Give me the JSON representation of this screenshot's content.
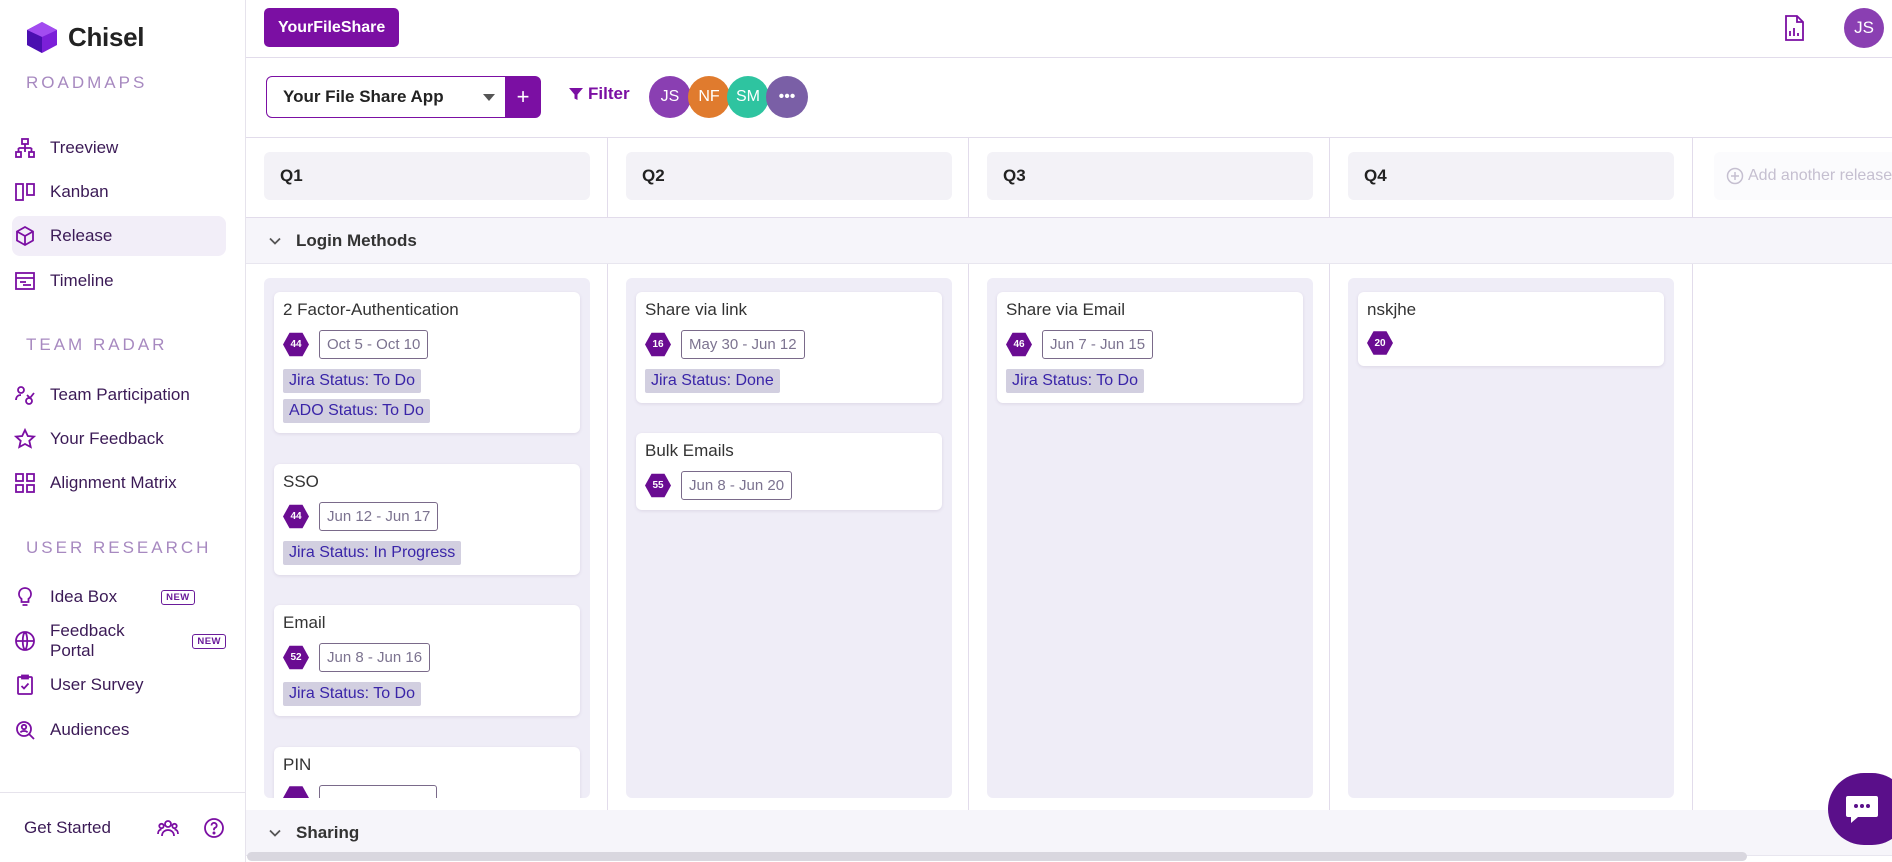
{
  "brand": {
    "name": "Chisel"
  },
  "sidebar": {
    "sections": [
      {
        "title": "ROADMAPS"
      },
      {
        "title": "TEAM RADAR"
      },
      {
        "title": "USER RESEARCH"
      }
    ],
    "items": [
      {
        "label": "Treeview",
        "icon": "treeview-icon"
      },
      {
        "label": "Kanban",
        "icon": "kanban-icon"
      },
      {
        "label": "Release",
        "icon": "release-icon",
        "active": true
      },
      {
        "label": "Timeline",
        "icon": "timeline-icon"
      },
      {
        "label": "Team Participation",
        "icon": "team-participation-icon"
      },
      {
        "label": "Your Feedback",
        "icon": "star-icon"
      },
      {
        "label": "Alignment Matrix",
        "icon": "grid-icon"
      },
      {
        "label": "Idea Box",
        "icon": "lightbulb-icon",
        "badge": "NEW"
      },
      {
        "label": "Feedback Portal",
        "icon": "globe-icon",
        "badge": "NEW"
      },
      {
        "label": "User Survey",
        "icon": "clipboard-icon"
      },
      {
        "label": "Audiences",
        "icon": "audience-search-icon"
      }
    ],
    "footer": {
      "get_started": "Get Started"
    }
  },
  "topbar": {
    "workspace": "YourFileShare",
    "user_initials": "JS"
  },
  "toolbar": {
    "app_select_value": "Your File Share App",
    "add_label": "+",
    "filter_label": "Filter",
    "members": [
      {
        "initials": "JS",
        "color": "#8a3fb2"
      },
      {
        "initials": "NF",
        "color": "#e07b2e"
      },
      {
        "initials": "SM",
        "color": "#2ec4a0"
      },
      {
        "initials": "•••",
        "color": "#7a5fa6"
      }
    ]
  },
  "board": {
    "columns": [
      "Q1",
      "Q2",
      "Q3",
      "Q4"
    ],
    "add_release": "Add another release",
    "groups": [
      {
        "label": "Login Methods"
      },
      {
        "label": "Sharing"
      }
    ],
    "cards": {
      "q1": [
        {
          "title": "2 Factor-Authentication",
          "score": "44",
          "dates": "Oct 5 - Oct 10",
          "tags": [
            "Jira Status: To Do",
            "ADO Status: To Do"
          ]
        },
        {
          "title": "SSO",
          "score": "44",
          "dates": "Jun 12 - Jun 17",
          "tags": [
            "Jira Status: In Progress"
          ]
        },
        {
          "title": "Email",
          "score": "52",
          "dates": "Jun 8 - Jun 16",
          "tags": [
            "Jira Status: To Do"
          ]
        },
        {
          "title": "PIN",
          "score": "",
          "dates": "",
          "tags": []
        }
      ],
      "q2": [
        {
          "title": "Share via link",
          "score": "16",
          "dates": "May 30 - Jun 12",
          "tags": [
            "Jira Status: Done"
          ]
        },
        {
          "title": "Bulk Emails",
          "score": "55",
          "dates": "Jun 8 - Jun 20",
          "tags": []
        }
      ],
      "q3": [
        {
          "title": "Share via Email",
          "score": "46",
          "dates": "Jun 7 - Jun 15",
          "tags": [
            "Jira Status: To Do"
          ]
        }
      ],
      "q4": [
        {
          "title": "nskjhe",
          "score": "20",
          "dates": "",
          "tags": []
        }
      ]
    }
  },
  "colors": {
    "accent": "#7b0fa3",
    "lane": "#efedf7",
    "tag_bg": "#d2cfe0"
  }
}
